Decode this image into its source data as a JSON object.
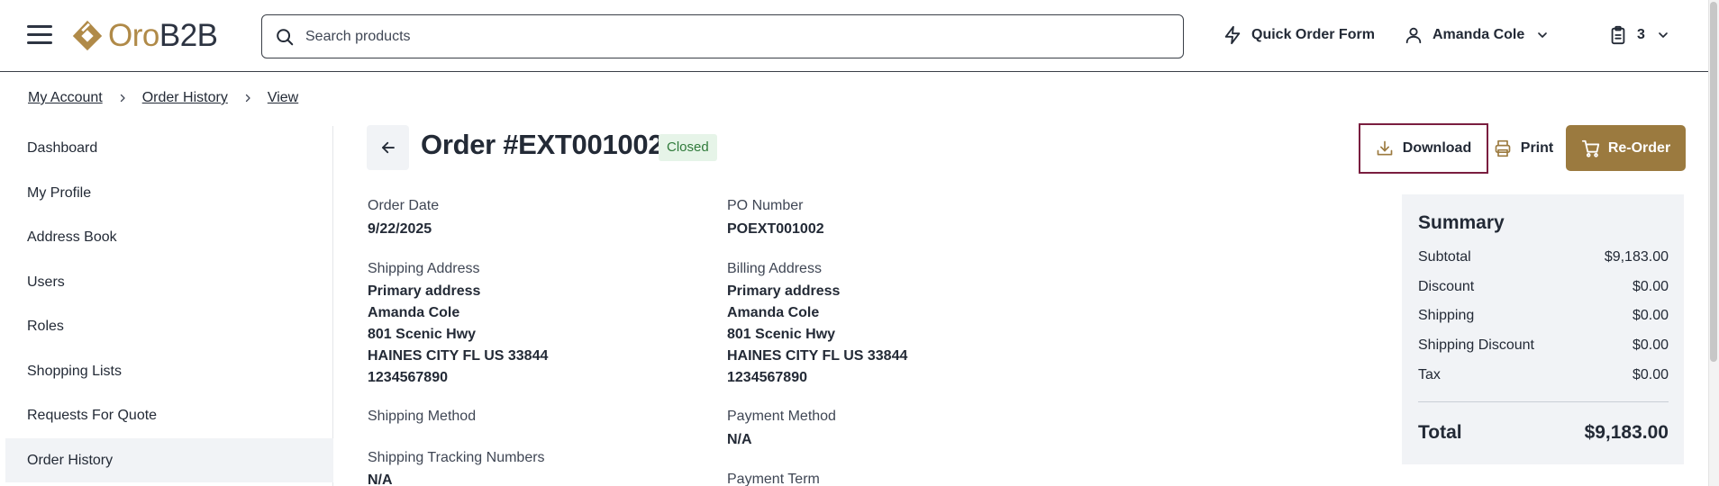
{
  "header": {
    "logo_oro": "Oro",
    "logo_b2b": "B2B",
    "search_placeholder": "Search products",
    "quick_order_label": "Quick Order Form",
    "user_name": "Amanda Cole",
    "cart_count": "3"
  },
  "breadcrumb": {
    "items": [
      "My Account",
      "Order History",
      "View"
    ]
  },
  "sidebar": {
    "items": [
      {
        "label": "Dashboard"
      },
      {
        "label": "My Profile"
      },
      {
        "label": "Address Book"
      },
      {
        "label": "Users"
      },
      {
        "label": "Roles"
      },
      {
        "label": "Shopping Lists"
      },
      {
        "label": "Requests For Quote"
      },
      {
        "label": "Order History",
        "active": true
      }
    ]
  },
  "order": {
    "title": "Order #EXT001002",
    "status": "Closed",
    "actions": {
      "download": "Download",
      "print": "Print",
      "reorder": "Re-Order"
    },
    "order_date_label": "Order Date",
    "order_date": "9/22/2025",
    "po_number_label": "PO Number",
    "po_number": "POEXT001002",
    "shipping_address_label": "Shipping Address",
    "shipping_address": [
      "Primary address",
      "Amanda Cole",
      "801 Scenic Hwy",
      "HAINES CITY FL US 33844",
      "1234567890"
    ],
    "billing_address_label": "Billing Address",
    "billing_address": [
      "Primary address",
      "Amanda Cole",
      "801 Scenic Hwy",
      "HAINES CITY FL US 33844",
      "1234567890"
    ],
    "shipping_method_label": "Shipping Method",
    "payment_method_label": "Payment Method",
    "payment_method": "N/A",
    "tracking_label": "Shipping Tracking Numbers",
    "tracking": "N/A",
    "payment_term_label": "Payment Term"
  },
  "summary": {
    "title": "Summary",
    "rows": [
      {
        "label": "Subtotal",
        "value": "$9,183.00"
      },
      {
        "label": "Discount",
        "value": "$0.00"
      },
      {
        "label": "Shipping",
        "value": "$0.00"
      },
      {
        "label": "Shipping Discount",
        "value": "$0.00"
      },
      {
        "label": "Tax",
        "value": "$0.00"
      }
    ],
    "total_label": "Total",
    "total_value": "$9,183.00"
  },
  "colors": {
    "brand_gold": "#9b7a3f",
    "text_dark": "#232a36",
    "focus_outline": "#7a1e3f",
    "status_closed_bg": "#e6f4e8",
    "status_closed_text": "#2f7a3a"
  }
}
